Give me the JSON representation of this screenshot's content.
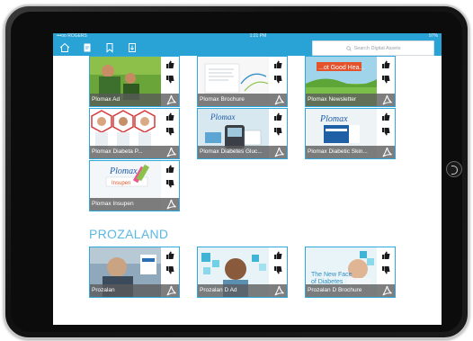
{
  "status_bar": {
    "carrier": "•••oo ROGERS",
    "time": "1:21 PM",
    "battery": "97%"
  },
  "toolbar": {
    "icons": [
      "home-icon",
      "document-icon",
      "bookmark-icon",
      "download-icon"
    ],
    "search_placeholder": "Search Digital Assets"
  },
  "sections": [
    {
      "title": "",
      "tiles": [
        {
          "caption": "Plomax Ad"
        },
        {
          "caption": "Plomax Brochure"
        },
        {
          "caption": "Plomax Newsletter"
        },
        {
          "caption": "Plomax Diabeta P..."
        },
        {
          "caption": "Plomax Diabetes Gluc..."
        },
        {
          "caption": "Plomax Diabetic Skin..."
        },
        {
          "caption": "Plomax Insupen"
        }
      ]
    },
    {
      "title": "PROZALAND",
      "tiles": [
        {
          "caption": "Prozalan"
        },
        {
          "caption": "Prozalan D Ad"
        },
        {
          "caption": "Prozalan D Brochure"
        }
      ]
    }
  ],
  "art_text": {
    "newsletter_overlay": "...ot Good Hea...",
    "plomax_logo": "Plomax",
    "insupen_label": "Insupen",
    "new_face": "The New Face",
    "of_diabetes": "of Diabetes"
  },
  "colors": {
    "accent": "#29a3d6",
    "tile_border": "#2fa8dc",
    "section_title": "#5bb8e3",
    "caption_bg": "#5a5a5a"
  }
}
